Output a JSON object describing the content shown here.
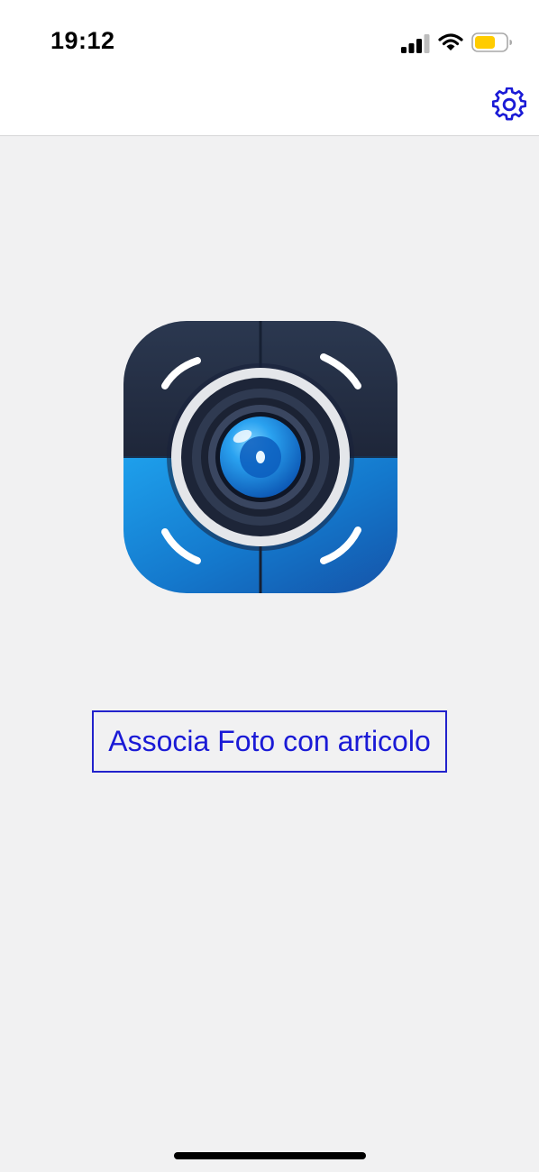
{
  "status_bar": {
    "time": "19:12",
    "icons": [
      "signal-icon",
      "wifi-icon",
      "battery-icon"
    ],
    "battery_color": "#ffcc00"
  },
  "nav_bar": {
    "settings_icon": "gear-icon",
    "accent_color": "#1a1ad6"
  },
  "main": {
    "logo": "camera-lens-app-logo",
    "associate_button_label": "Associa Foto con articolo"
  }
}
